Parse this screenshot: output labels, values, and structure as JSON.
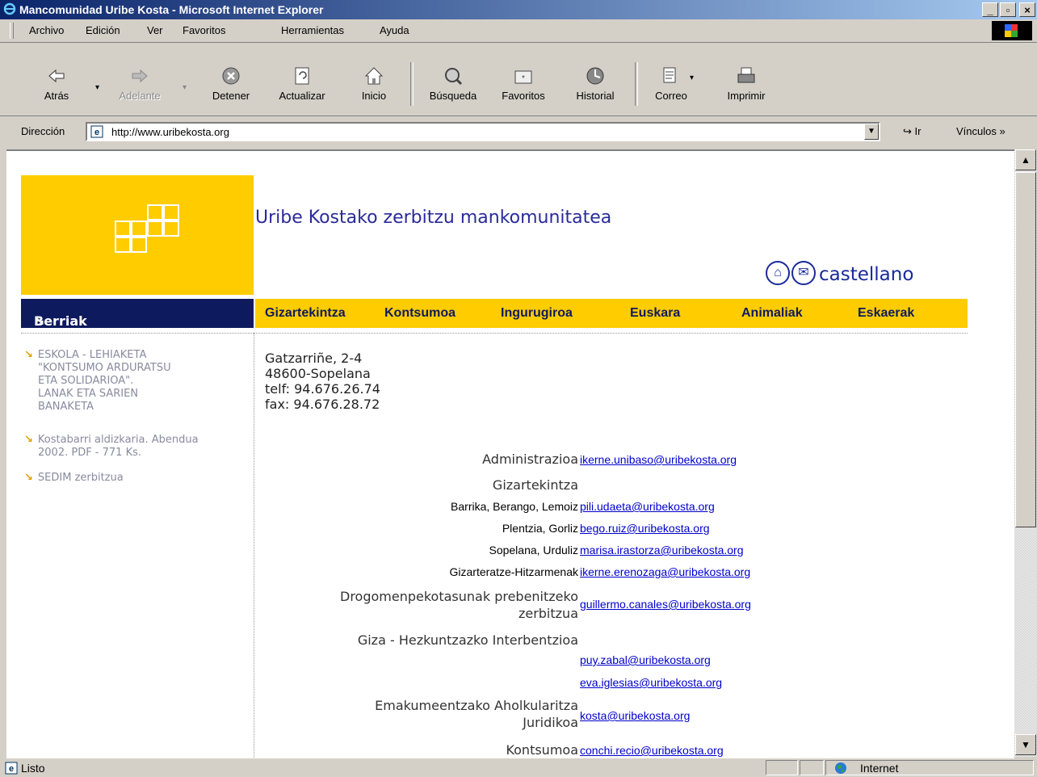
{
  "window": {
    "title": "Mancomunidad Uribe Kosta - Microsoft Internet Explorer"
  },
  "menu": {
    "items": [
      "Archivo",
      "Edición",
      "Ver",
      "Favoritos",
      "Herramientas",
      "Ayuda"
    ]
  },
  "toolbar": {
    "back": "Atrás",
    "forward": "Adelante",
    "stop": "Detener",
    "refresh": "Actualizar",
    "home": "Inicio",
    "search": "Búsqueda",
    "favorites": "Favoritos",
    "history": "Historial",
    "mail": "Correo",
    "print": "Imprimir"
  },
  "address": {
    "label": "Dirección",
    "url": "http://www.uribekosta.org",
    "go": "Ir",
    "links": "Vínculos"
  },
  "page": {
    "site_title": "Uribe Kostako zerbitzu mankomunitatea",
    "lang_link": "castellano",
    "side_header": "Berriak",
    "nav": [
      "Gizartekintza",
      "Kontsumoa",
      "Ingurugiroa",
      "Euskara",
      "Animaliak",
      "Eskaerak"
    ],
    "news": [
      [
        "ESKOLA - LEHIAKETA",
        "\"KONTSUMO ARDURATSU",
        "ETA SOLIDARIOA\".",
        "LANAK ETA SARIEN",
        "BANAKETA"
      ],
      [
        "Kostabarri aldizkaria. Abendua",
        "2002. PDF - 771 Ks."
      ],
      [
        "SEDIM zerbitzua"
      ]
    ],
    "address_lines": [
      "Gatzarriñe, 2-4",
      "48600-Sopelana",
      "telf: 94.676.26.74",
      "fax: 94.676.28.72"
    ],
    "contacts": {
      "administrazioa": {
        "label": "Administrazioa",
        "email": "ikerne.unibaso@uribekosta.org"
      },
      "gizartekintza": {
        "label": "Gizartekintza"
      },
      "barrika": {
        "label": "Barrika, Berango, Lemoiz",
        "email": "pili.udaeta@uribekosta.org"
      },
      "plentzia": {
        "label": "Plentzia, Gorliz",
        "email": "bego.ruiz@uribekosta.org"
      },
      "sopelana": {
        "label": "Sopelana, Urduliz",
        "email": "marisa.irastorza@uribekosta.org"
      },
      "hitzarmenak": {
        "label": "Gizarteratze-Hitzarmenak",
        "email": "ikerne.erenozaga@uribekosta.org"
      },
      "drogo": {
        "label1": "Drogomenpekotasunak prebenitzeko",
        "label2": "zerbitzua",
        "email": "guillermo.canales@uribekosta.org"
      },
      "giza": {
        "label": "Giza - Hezkuntzazko Interbentzioa",
        "email1": "puy.zabal@uribekosta.org",
        "email2": "eva.iglesias@uribekosta.org"
      },
      "emakume": {
        "label1": "Emakumeentzako Aholkularitza",
        "label2": "Juridikoa",
        "email": "kosta@uribekosta.org"
      },
      "kontsumoa": {
        "label": "Kontsumoa",
        "email": "conchi.recio@uribekosta.org"
      }
    }
  },
  "status": {
    "text": "Listo",
    "zone": "Internet"
  }
}
